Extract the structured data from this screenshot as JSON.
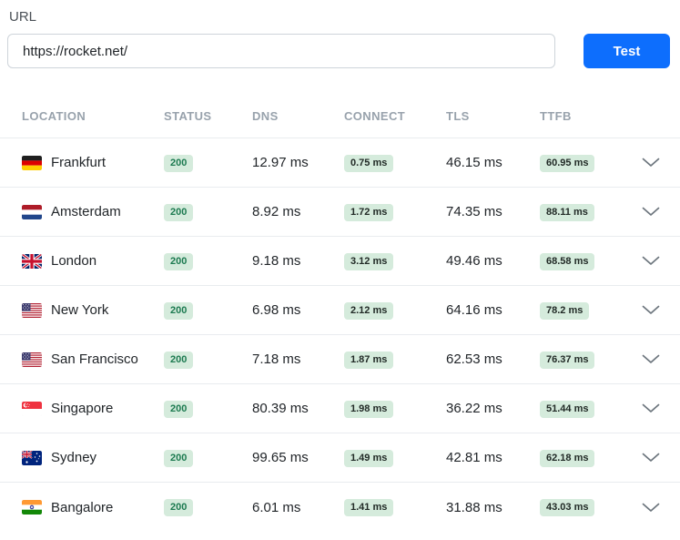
{
  "url_section": {
    "label": "URL",
    "input_value": "https://rocket.net/",
    "test_button_label": "Test"
  },
  "colors": {
    "accent_blue": "#0d6efd",
    "badge_background": "#d5ebdc",
    "status_badge_text": "#1c7a50",
    "metric_badge_text": "#212a26",
    "header_text": "#98a2ac",
    "row_divider": "#e9ecef"
  },
  "table": {
    "columns": [
      "LOCATION",
      "STATUS",
      "DNS",
      "CONNECT",
      "TLS",
      "TTFB"
    ],
    "rows": [
      {
        "location": "Frankfurt",
        "flag": "de",
        "status": "200",
        "dns": "12.97 ms",
        "connect": "0.75 ms",
        "tls": "46.15 ms",
        "ttfb": "60.95 ms"
      },
      {
        "location": "Amsterdam",
        "flag": "nl",
        "status": "200",
        "dns": "8.92 ms",
        "connect": "1.72 ms",
        "tls": "74.35 ms",
        "ttfb": "88.11 ms"
      },
      {
        "location": "London",
        "flag": "gb",
        "status": "200",
        "dns": "9.18 ms",
        "connect": "3.12 ms",
        "tls": "49.46 ms",
        "ttfb": "68.58 ms"
      },
      {
        "location": "New York",
        "flag": "us",
        "status": "200",
        "dns": "6.98 ms",
        "connect": "2.12 ms",
        "tls": "64.16 ms",
        "ttfb": "78.2 ms"
      },
      {
        "location": "San Francisco",
        "flag": "us",
        "status": "200",
        "dns": "7.18 ms",
        "connect": "1.87 ms",
        "tls": "62.53 ms",
        "ttfb": "76.37 ms"
      },
      {
        "location": "Singapore",
        "flag": "sg",
        "status": "200",
        "dns": "80.39 ms",
        "connect": "1.98 ms",
        "tls": "36.22 ms",
        "ttfb": "51.44 ms"
      },
      {
        "location": "Sydney",
        "flag": "au",
        "status": "200",
        "dns": "99.65 ms",
        "connect": "1.49 ms",
        "tls": "42.81 ms",
        "ttfb": "62.18 ms"
      },
      {
        "location": "Bangalore",
        "flag": "in",
        "status": "200",
        "dns": "6.01 ms",
        "connect": "1.41 ms",
        "tls": "31.88 ms",
        "ttfb": "43.03 ms"
      }
    ]
  }
}
